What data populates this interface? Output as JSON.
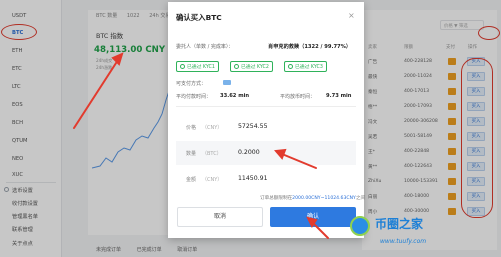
{
  "sidebar": {
    "coins": [
      "USDT",
      "BTC",
      "ETH",
      "ETC",
      "LTC",
      "EOS",
      "BCH",
      "QTUM",
      "NEO",
      "XUC"
    ],
    "active_coin": "BTC",
    "section_title": "选币设置",
    "links": [
      "收付款设置",
      "管理黑名单",
      "联系管理",
      "关于点点"
    ]
  },
  "chart": {
    "tabs": [
      "BTC 数量",
      "1022",
      "24h 交易量"
    ],
    "title": "BTC 指数",
    "price": "48,113.00 CNY",
    "stats": [
      "24h成交",
      "24h涨跌"
    ],
    "bottom_tabs": [
      "未完成订单",
      "已完成订单",
      "取消订单"
    ]
  },
  "table": {
    "filter_placeholder": "价格 ▼ 筛选",
    "columns": [
      "卖家",
      "限额",
      "支付",
      "操作"
    ],
    "rows": [
      {
        "seller": "广告",
        "range": "400-228128",
        "buy": "买入"
      },
      {
        "seller": "最快",
        "range": "2000-11024",
        "buy": "买入"
      },
      {
        "seller": "秦恒",
        "range": "400-17013",
        "buy": "买入"
      },
      {
        "seller": "梧**",
        "range": "2000-17093",
        "buy": "买入"
      },
      {
        "seller": "冯文",
        "range": "20000-306208",
        "buy": "买入"
      },
      {
        "seller": "吴若",
        "range": "5001-58149",
        "buy": "买入"
      },
      {
        "seller": "王*",
        "range": "400-22848",
        "buy": "买入"
      },
      {
        "seller": "黄**",
        "range": "400-122643",
        "buy": "买入"
      },
      {
        "seller": "ZhiXu",
        "range": "10000-153391",
        "buy": "买入"
      },
      {
        "seller": "白丽",
        "range": "400-18000",
        "buy": "买入"
      },
      {
        "seller": "周小",
        "range": "400-30000",
        "buy": "买入"
      }
    ]
  },
  "modal": {
    "title": "确认买入BTC",
    "close": "×",
    "trader_label": "委托人（单数 / 完成率）：",
    "trader_value": "肖申克的救赎（1322 / 99.77%）",
    "kyc": [
      "已通过 KYC1",
      "已通过 KYC2",
      "已通过 KYC3"
    ],
    "payment_label": "可支付方式：",
    "avg_pay_label": "平均付款时间：",
    "avg_pay_value": "33.62 min",
    "avg_release_label": "平均放币时间：",
    "avg_release_value": "9.73 min",
    "fields": [
      {
        "label": "价格",
        "unit": "（CNY）",
        "value": "57254.55"
      },
      {
        "label": "数量",
        "unit": "（BTC）",
        "value": "0.2000"
      },
      {
        "label": "金额",
        "unit": "（CNY）",
        "value": "11450.91"
      }
    ],
    "note_prefix": "订单总额限制在",
    "note_link": "2000.00CNY~11024.63CNY",
    "note_suffix": "之间",
    "cancel": "取消",
    "confirm": "确认"
  },
  "watermark": {
    "brand": "币圈之家",
    "url": "www.tuufy.com"
  },
  "colors": {
    "accent": "#2e7ae0",
    "price_green": "#1fa34a",
    "kyc_green": "#2fb25a",
    "annotation_red": "#e23b2e"
  }
}
